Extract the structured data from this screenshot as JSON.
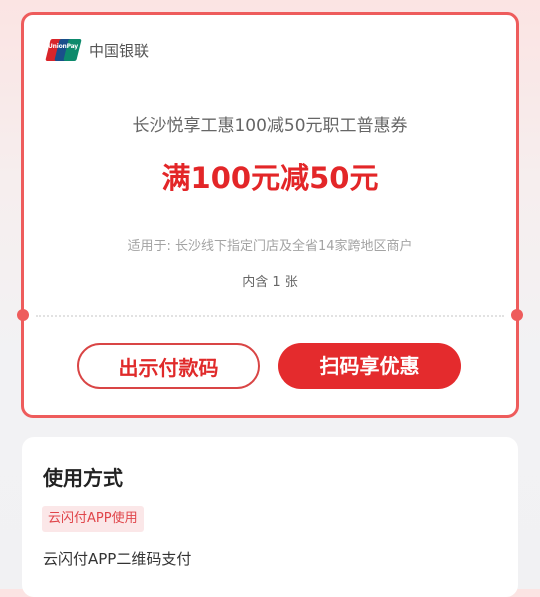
{
  "brand": {
    "name": "中国银联",
    "logo_text": "UnionPay 银联"
  },
  "coupon": {
    "subtitle": "长沙悦享工惠100减50元职工普惠券",
    "headline": "满100元减50元",
    "scope": "适用于: 长沙线下指定门店及全省14家跨地区商户",
    "count": "内含 1 张"
  },
  "buttons": {
    "show_code": "出示付款码",
    "scan": "扫码享优惠"
  },
  "usage": {
    "title": "使用方式",
    "tag": "云闪付APP使用",
    "desc": "云闪付APP二维码支付"
  },
  "colors": {
    "accent": "#e42b2d",
    "border": "#ee5c5c",
    "tag_bg": "#fbe7e8"
  }
}
